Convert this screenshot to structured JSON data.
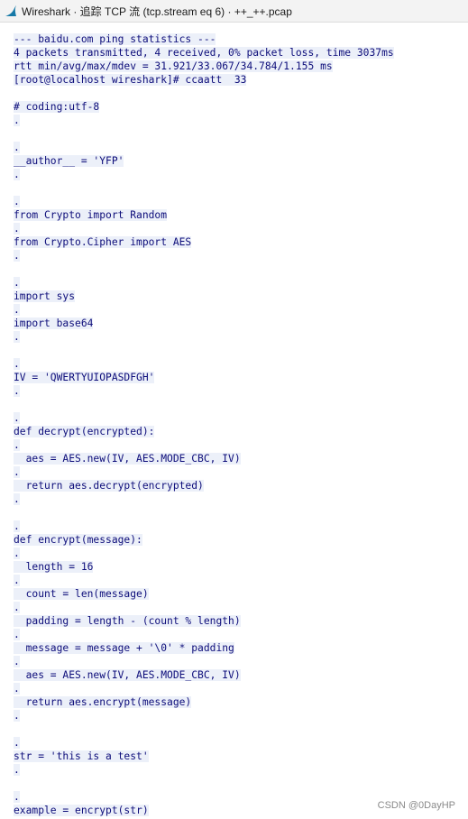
{
  "window": {
    "title": "Wireshark · 追踪 TCP 流 (tcp.stream eq 6) · ++_++.pcap"
  },
  "icons": {
    "app_icon": "wireshark-fin-icon",
    "app_icon_color": "#1679a7"
  },
  "colors": {
    "stream_text": "#0d0d7a",
    "stream_highlight": "#ecf0f9"
  },
  "stream": {
    "lines": [
      "--- baidu.com ping statistics ---",
      "4 packets transmitted, 4 received, 0% packet loss, time 3037ms",
      "rtt min/avg/max/mdev = 31.921/33.067/34.784/1.155 ms",
      "[root@localhost wireshark]# ccaatt  33",
      "",
      "# coding:utf-8",
      ".",
      "",
      ".",
      "__author__ = 'YFP'",
      ".",
      "",
      ".",
      "from Crypto import Random",
      ".",
      "from Crypto.Cipher import AES",
      ".",
      "",
      ".",
      "import sys",
      ".",
      "import base64",
      ".",
      "",
      ".",
      "IV = 'QWERTYUIOPASDFGH'",
      ".",
      "",
      ".",
      "def decrypt(encrypted):",
      ".",
      "  aes = AES.new(IV, AES.MODE_CBC, IV)",
      ".",
      "  return aes.decrypt(encrypted)",
      ".",
      "",
      ".",
      "def encrypt(message):",
      ".",
      "  length = 16",
      ".",
      "  count = len(message)",
      ".",
      "  padding = length - (count % length)",
      ".",
      "  message = message + '\\0' * padding",
      ".",
      "  aes = AES.new(IV, AES.MODE_CBC, IV)",
      ".",
      "  return aes.encrypt(message)",
      ".",
      "",
      ".",
      "str = 'this is a test'",
      ".",
      "",
      ".",
      "example = encrypt(str)"
    ]
  },
  "watermark": {
    "text": "CSDN @0DayHP"
  }
}
